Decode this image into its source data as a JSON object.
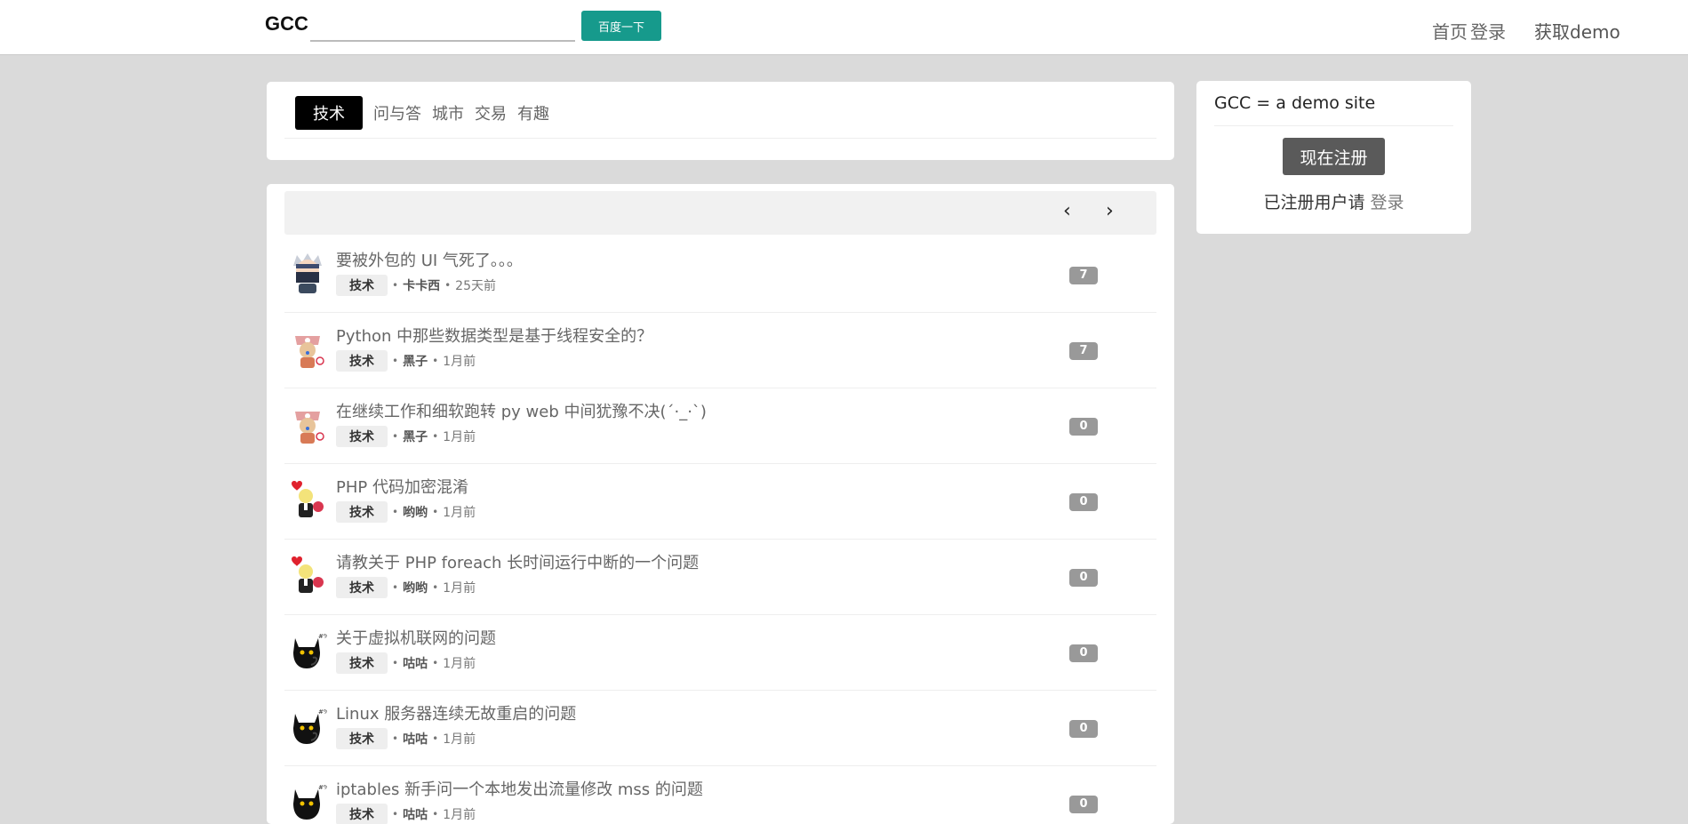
{
  "header": {
    "logo": "GCC",
    "search_placeholder": "",
    "search_button": "百度一下",
    "nav": {
      "home": "首页",
      "login": "登录",
      "demo": "获取demo"
    }
  },
  "tabs": [
    {
      "label": "技术",
      "active": true
    },
    {
      "label": "问与答",
      "active": false
    },
    {
      "label": "城市",
      "active": false
    },
    {
      "label": "交易",
      "active": false
    },
    {
      "label": "有趣",
      "active": false
    }
  ],
  "pager": {
    "prev": "‹",
    "next": "›"
  },
  "topics": [
    {
      "title": "要被外包的 UI 气死了。。。",
      "tag": "技术",
      "author": "卡卡西",
      "time": "25天前",
      "replies": "7",
      "avatar": "kakashi-avatar"
    },
    {
      "title": "Python 中那些数据类型是基于线程安全的？",
      "tag": "技术",
      "author": "黑子",
      "time": "1月前",
      "replies": "7",
      "avatar": "chopper-avatar"
    },
    {
      "title": "在继续工作和细软跑转 py web 中间犹豫不决(´·_·`)",
      "tag": "技术",
      "author": "黑子",
      "time": "1月前",
      "replies": "0",
      "avatar": "chopper-avatar"
    },
    {
      "title": "PHP 代码加密混淆",
      "tag": "技术",
      "author": "哟哟",
      "time": "1月前",
      "replies": "0",
      "avatar": "sanji-avatar"
    },
    {
      "title": "请教关于 PHP foreach 长时间运行中断的一个问题",
      "tag": "技术",
      "author": "哟哟",
      "time": "1月前",
      "replies": "0",
      "avatar": "sanji-avatar"
    },
    {
      "title": "关于虚拟机联网的问题",
      "tag": "技术",
      "author": "咕咕",
      "time": "1月前",
      "replies": "0",
      "avatar": "black-cat-avatar"
    },
    {
      "title": "Linux 服务器连续无故重启的问题",
      "tag": "技术",
      "author": "咕咕",
      "time": "1月前",
      "replies": "0",
      "avatar": "black-cat-avatar"
    },
    {
      "title": "iptables 新手问一个本地发出流量修改 mss 的问题",
      "tag": "技术",
      "author": "咕咕",
      "time": "1月前",
      "replies": "0",
      "avatar": "black-cat-avatar"
    }
  ],
  "sidebar": {
    "title": "GCC = a demo site",
    "register_button": "现在注册",
    "login_prompt": "已注册用户请",
    "login_link": "登录"
  },
  "colors": {
    "accent": "#169a8c",
    "background": "#dadada",
    "active_tab": "#000000",
    "count_badge": "#999999",
    "register_button": "#5a5a5a"
  }
}
